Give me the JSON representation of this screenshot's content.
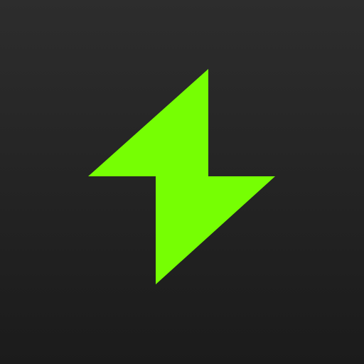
{
  "app_icon": {
    "icon": "lightning-bolt-icon",
    "colors": {
      "bolt": "#76ff03",
      "background_top": "#2d2d2d",
      "background_bottom": "#1b1b1b"
    }
  }
}
